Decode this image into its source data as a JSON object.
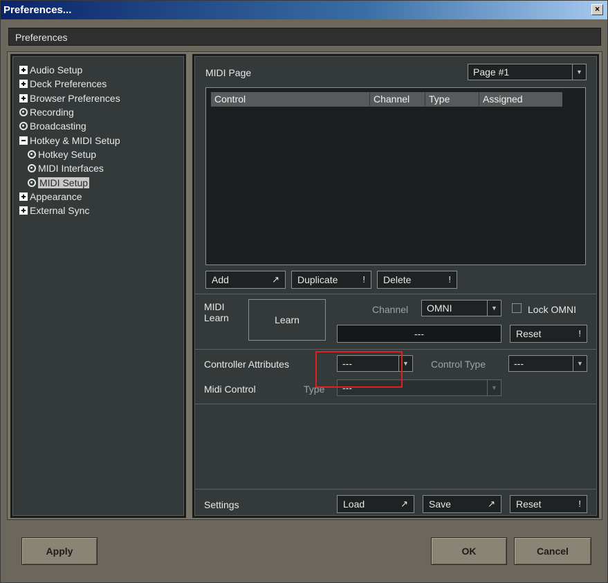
{
  "window": {
    "title": "Preferences...",
    "close_label": "×"
  },
  "header": {
    "title": "Preferences"
  },
  "tree": {
    "items": [
      {
        "label": "Audio Setup",
        "icon": "plus-icon"
      },
      {
        "label": "Deck Preferences",
        "icon": "plus-icon"
      },
      {
        "label": "Browser Preferences",
        "icon": "plus-icon"
      },
      {
        "label": "Recording",
        "icon": "circle-icon"
      },
      {
        "label": "Broadcasting",
        "icon": "circle-icon"
      },
      {
        "label": "Hotkey & MIDI Setup",
        "icon": "minus-icon"
      },
      {
        "label": "Hotkey Setup",
        "icon": "circle-icon",
        "child": true
      },
      {
        "label": "MIDI Interfaces",
        "icon": "circle-icon",
        "child": true
      },
      {
        "label": "MIDI Setup",
        "icon": "circle-icon",
        "child": true,
        "selected": true
      },
      {
        "label": "Appearance",
        "icon": "plus-icon"
      },
      {
        "label": "External Sync",
        "icon": "plus-icon"
      }
    ]
  },
  "midi_page": {
    "label": "MIDI Page",
    "page_select": "Page #1",
    "columns": [
      "Control",
      "Channel",
      "Type",
      "Assigned"
    ],
    "rows": []
  },
  "list_buttons": {
    "add": "Add",
    "add_mark": "↗",
    "duplicate": "Duplicate",
    "duplicate_mark": "!",
    "delete": "Delete",
    "delete_mark": "!"
  },
  "midi_learn": {
    "label_line1": "MIDI",
    "label_line2": "Learn",
    "learn_button": "Learn",
    "channel_label": "Channel",
    "channel_value": "OMNI",
    "lock_omni_label": "Lock OMNI",
    "lock_omni_checked": false,
    "value_display": "---",
    "reset_label": "Reset",
    "reset_mark": "!"
  },
  "attributes": {
    "controller_attributes_label": "Controller Attributes",
    "controller_attributes_value": "---",
    "control_type_label": "Control Type",
    "control_type_value": "---",
    "midi_control_label": "Midi Control",
    "type_label": "Type",
    "type_value": "---"
  },
  "settings": {
    "label": "Settings",
    "load": "Load",
    "load_mark": "↗",
    "save": "Save",
    "save_mark": "↗",
    "reset": "Reset",
    "reset_mark": "!"
  },
  "footer": {
    "apply": "Apply",
    "ok": "OK",
    "cancel": "Cancel"
  },
  "colors": {
    "highlight": "#e02020",
    "panel": "#343a3a",
    "frame": "#7a7466"
  }
}
